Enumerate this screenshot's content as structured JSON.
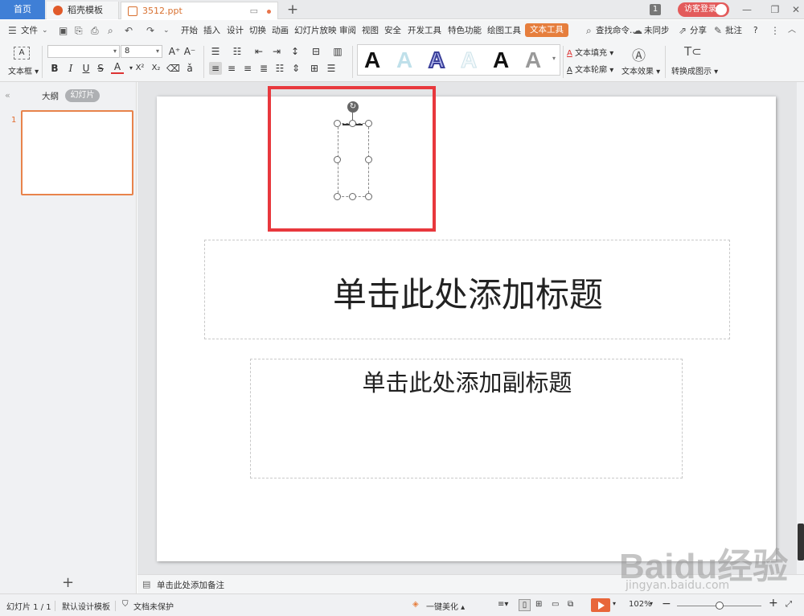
{
  "tabs": {
    "home": "首页",
    "daoke": "稻壳模板",
    "doc": "3512.ppt",
    "new_tab": "+"
  },
  "titlebar": {
    "window_count": "1",
    "login": "访客登录"
  },
  "menu": {
    "file": "文件",
    "items": [
      "开始",
      "插入",
      "设计",
      "切换",
      "动画",
      "幻灯片放映",
      "审阅",
      "视图",
      "安全",
      "开发工具",
      "特色功能",
      "绘图工具"
    ],
    "active": "文本工具",
    "search": "查找命令...",
    "sync": "未同步",
    "share": "分享",
    "comment": "批注",
    "help": "?"
  },
  "ribbon": {
    "textbox_label": "文本框",
    "font_name": "",
    "font_size": "8",
    "bold": "B",
    "italic": "I",
    "underline": "U",
    "font_color": "A",
    "superscript": "X²",
    "subscript": "X₂",
    "text_fill": "文本填充",
    "text_outline": "文本轮廓",
    "text_effects": "文本效果",
    "convert_smartart": "转换成图示",
    "style_letter": "A"
  },
  "left_panel": {
    "outline": "大纲",
    "slides": "幻灯片",
    "slide_number": "1",
    "add": "+"
  },
  "slide": {
    "title_placeholder": "单击此处添加标题",
    "subtitle_placeholder": "单击此处添加副标题"
  },
  "notes": {
    "placeholder": "单击此处添加备注"
  },
  "status": {
    "slide_counter": "幻灯片 1 / 1",
    "template": "默认设计模板",
    "protection": "文档未保护",
    "beautify": "一键美化",
    "zoom": "102%"
  },
  "watermark": {
    "brand": "Baidu经验",
    "url": "jingyan.baidu.com"
  },
  "colors": {
    "accent_orange": "#e67e3d",
    "home_tab_blue": "#3f7fd6",
    "highlight_red": "#e8383d"
  }
}
